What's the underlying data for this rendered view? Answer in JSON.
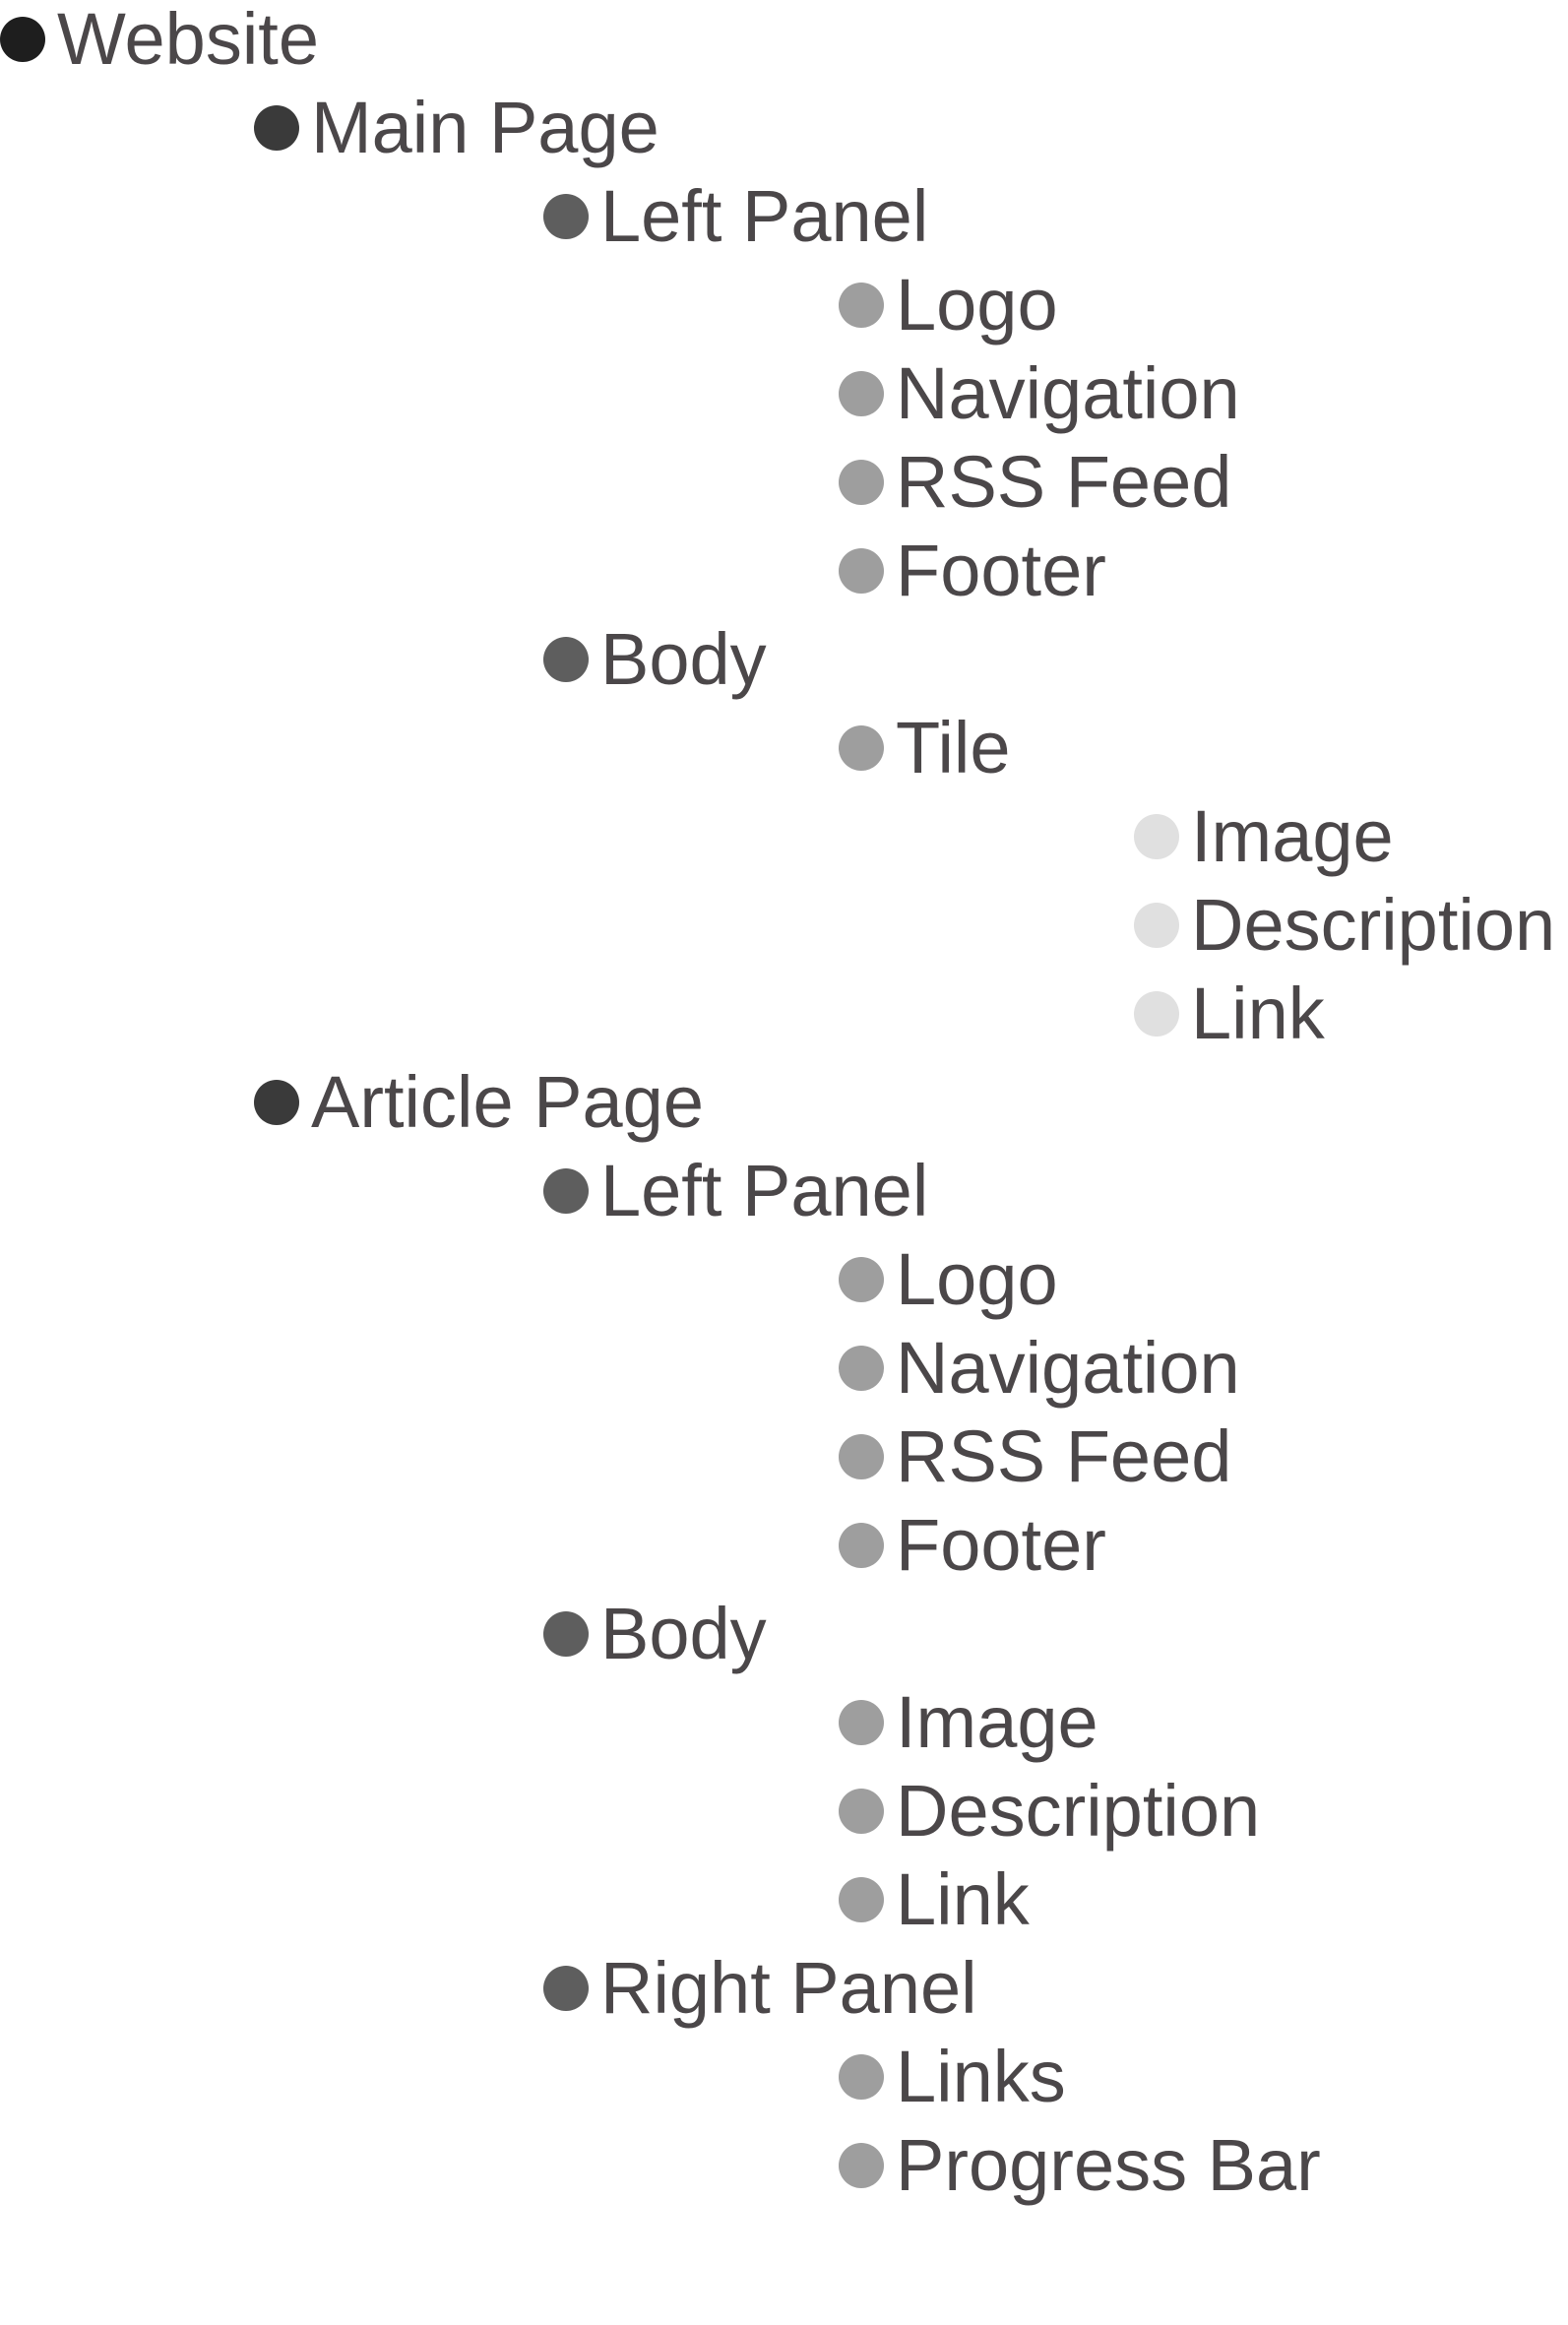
{
  "outline": {
    "colors": {
      "text": "#4b4749",
      "level_0": "#1e1e1e",
      "level_1": "#3a3a3a",
      "level_2": "#5e5e5e",
      "level_3": "#9e9e9e",
      "level_4": "#e0e0e0"
    },
    "items": [
      {
        "label": "Website",
        "level": 0
      },
      {
        "label": "Main Page",
        "level": 1
      },
      {
        "label": "Left Panel",
        "level": 2
      },
      {
        "label": "Logo",
        "level": 3
      },
      {
        "label": "Navigation",
        "level": 3
      },
      {
        "label": "RSS Feed",
        "level": 3
      },
      {
        "label": "Footer",
        "level": 3
      },
      {
        "label": "Body",
        "level": 2
      },
      {
        "label": "Tile",
        "level": 3
      },
      {
        "label": "Image",
        "level": 4
      },
      {
        "label": "Description",
        "level": 4
      },
      {
        "label": "Link",
        "level": 4
      },
      {
        "label": "Article Page",
        "level": 1
      },
      {
        "label": "Left Panel",
        "level": 2
      },
      {
        "label": "Logo",
        "level": 3
      },
      {
        "label": "Navigation",
        "level": 3
      },
      {
        "label": "RSS Feed",
        "level": 3
      },
      {
        "label": "Footer",
        "level": 3
      },
      {
        "label": "Body",
        "level": 2
      },
      {
        "label": "Image",
        "level": 3
      },
      {
        "label": "Description",
        "level": 3
      },
      {
        "label": "Link",
        "level": 3
      },
      {
        "label": "Right Panel",
        "level": 2
      },
      {
        "label": "Links",
        "level": 3
      },
      {
        "label": "Progress Bar",
        "level": 3
      }
    ]
  }
}
